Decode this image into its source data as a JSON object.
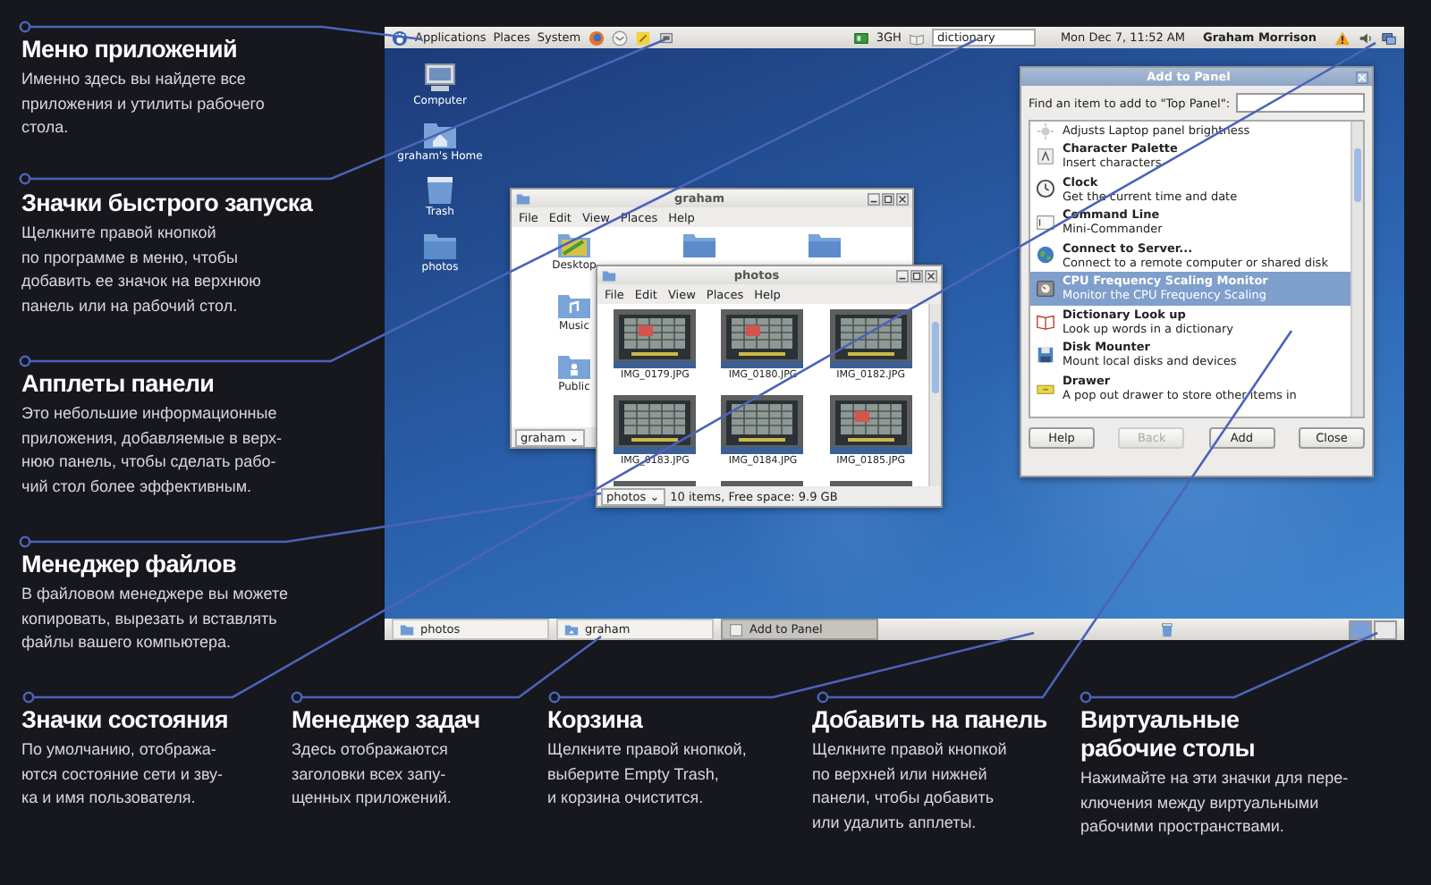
{
  "callouts_left": [
    {
      "title": "Меню приложений",
      "lines": [
        "Именно здесь вы найдете все",
        "приложения и утилиты рабочего",
        "стола."
      ]
    },
    {
      "title": "Значки быстрого запуска",
      "lines": [
        "Щелкните правой кнопкой",
        "по программе в меню, чтобы",
        "добавить ее значок на верхнюю",
        "панель или на рабочий стол."
      ]
    },
    {
      "title": "Апплеты панели",
      "lines": [
        "Это небольшие информационные",
        "приложения, добавляемые в верх-",
        "нюю панель, чтобы сделать рабо-",
        "чий стол более эффективным."
      ]
    },
    {
      "title": "Менеджер файлов",
      "lines": [
        "В файловом менеджере вы можете",
        "копировать, вырезать и вставлять",
        "файлы вашего компьютера."
      ]
    }
  ],
  "callouts_bottom": [
    {
      "title": "Значки состояния",
      "lines": [
        "По умолчанию, отобража-",
        "ются состояние сети и зву-",
        "ка и имя пользователя."
      ]
    },
    {
      "title": "Менеджер задач",
      "lines": [
        "Здесь отображаются",
        "заголовки всех запу-",
        "щенных приложений."
      ]
    },
    {
      "title": "Корзина",
      "lines": [
        "Щелкните правой кнопкой,",
        "выберите Empty Trash,",
        "и корзина очистится."
      ]
    },
    {
      "title": "Добавить на панель",
      "lines": [
        "Щелкните правой кнопкой",
        "по верхней или нижней",
        "панели, чтобы добавить",
        "или удалить апплеты."
      ]
    },
    {
      "title": "Виртуальные рабочие столы",
      "lines": [
        "Нажимайте на эти значки для пере-",
        "ключения между виртуальными",
        "рабочими пространствами."
      ]
    }
  ],
  "top_panel": {
    "menus": [
      "Applications",
      "Places",
      "System"
    ],
    "network": "3GH",
    "dictionary": {
      "value": "dictionary"
    },
    "clock": "Mon Dec  7, 11:52 AM",
    "user": "Graham Morrison"
  },
  "desktop_icons": [
    {
      "kind": "computer",
      "label": "Computer"
    },
    {
      "kind": "home",
      "label": "graham's Home"
    },
    {
      "kind": "trash",
      "label": "Trash"
    },
    {
      "kind": "folder",
      "label": "photos"
    }
  ],
  "home_window": {
    "title": "graham",
    "menu": [
      "File",
      "Edit",
      "View",
      "Places",
      "Help"
    ],
    "items": [
      {
        "kind": "desktop",
        "label": "Desktop"
      },
      {
        "kind": "folder"
      },
      {
        "kind": "folder"
      },
      {
        "kind": "music",
        "label": "Music"
      },
      {
        "kind": "public",
        "label": "Public"
      }
    ],
    "path": "graham ⌄"
  },
  "photos_window": {
    "title": "photos",
    "menu": [
      "File",
      "Edit",
      "View",
      "Places",
      "Help"
    ],
    "thumbnails": [
      "IMG_0179.JPG",
      "IMG_0180.JPG",
      "IMG_0182.JPG",
      "IMG_0183.JPG",
      "IMG_0184.JPG",
      "IMG_0185.JPG"
    ],
    "path": "photos ⌄",
    "status": "10 items, Free space: 9.9 GB"
  },
  "add_dialog": {
    "title": "Add to Panel",
    "prompt": "Find an item to add to \"Top Panel\":",
    "items": [
      {
        "kind": "brightness",
        "description": "Adjusts Laptop panel brightness",
        "selected": false
      },
      {
        "kind": "charmap",
        "name": "Character Palette",
        "description": "Insert characters",
        "selected": false
      },
      {
        "kind": "clock",
        "name": "Clock",
        "description": "Get the current time and date",
        "selected": false
      },
      {
        "kind": "terminal",
        "name": "Command Line",
        "description": "Mini-Commander",
        "selected": false
      },
      {
        "kind": "globe",
        "name": "Connect to Server...",
        "description": "Connect to a remote computer or shared disk",
        "selected": false
      },
      {
        "kind": "cpu",
        "name": "CPU Frequency Scaling Monitor",
        "description": "Monitor the CPU Frequency Scaling",
        "selected": true
      },
      {
        "kind": "dictionary",
        "name": "Dictionary Look up",
        "description": "Look up words in a dictionary",
        "selected": false
      },
      {
        "kind": "disk",
        "name": "Disk Mounter",
        "description": "Mount local disks and devices",
        "selected": false
      },
      {
        "kind": "drawer",
        "name": "Drawer",
        "description": "A pop out drawer to store other items in",
        "selected": false
      }
    ],
    "buttons": [
      {
        "label": "Help",
        "disabled": false
      },
      {
        "label": "Back",
        "disabled": true
      },
      {
        "label": "Add",
        "disabled": false
      },
      {
        "label": "Close",
        "disabled": false
      }
    ]
  },
  "bottom_panel": {
    "tasks": [
      {
        "kind": "folder",
        "label": "photos",
        "selected": false
      },
      {
        "kind": "home",
        "label": "graham",
        "selected": false
      },
      {
        "kind": "dialog",
        "label": "Add to Panel",
        "selected": true
      }
    ],
    "workspaces": [
      {
        "selected": true
      },
      {
        "selected": false
      }
    ]
  }
}
